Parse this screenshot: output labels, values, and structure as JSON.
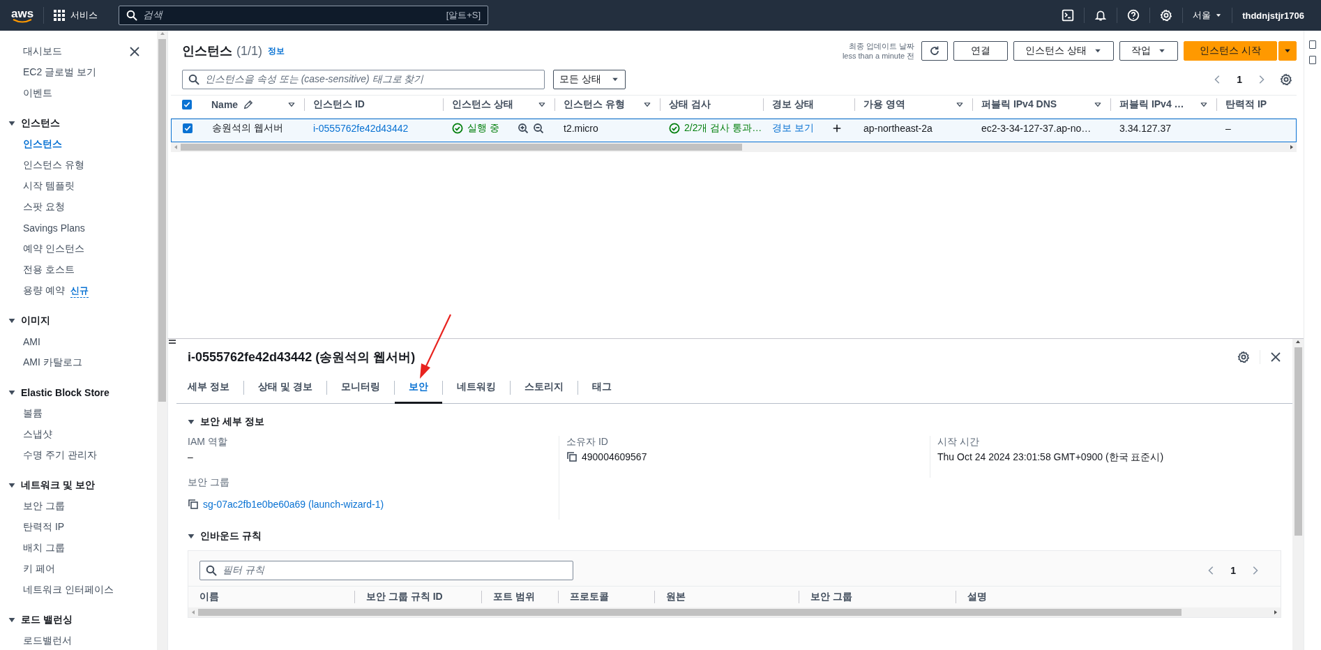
{
  "top_bar": {
    "logo": "aws",
    "services": "서비스",
    "search_placeholder": "검색",
    "search_shortcut": "[알트+S]",
    "region": "서울",
    "user": "thddnjstjr1706"
  },
  "sidebar": {
    "groups": [
      {
        "items": [
          {
            "label": "대시보드",
            "selected": false
          },
          {
            "label": "EC2 글로벌 보기",
            "selected": false
          },
          {
            "label": "이벤트",
            "selected": false
          }
        ]
      },
      {
        "title": "인스턴스",
        "expanded": true,
        "items": [
          {
            "label": "인스턴스",
            "selected": true
          },
          {
            "label": "인스턴스 유형",
            "selected": false
          },
          {
            "label": "시작 템플릿",
            "selected": false
          },
          {
            "label": "스팟 요청",
            "selected": false
          },
          {
            "label": "Savings Plans",
            "selected": false
          },
          {
            "label": "예약 인스턴스",
            "selected": false
          },
          {
            "label": "전용 호스트",
            "selected": false
          },
          {
            "label": "용량 예약",
            "selected": false,
            "badge": "신규"
          }
        ]
      },
      {
        "title": "이미지",
        "expanded": true,
        "items": [
          {
            "label": "AMI",
            "selected": false
          },
          {
            "label": "AMI 카탈로그",
            "selected": false
          }
        ]
      },
      {
        "title": "Elastic Block Store",
        "expanded": true,
        "items": [
          {
            "label": "볼륨",
            "selected": false
          },
          {
            "label": "스냅샷",
            "selected": false
          },
          {
            "label": "수명 주기 관리자",
            "selected": false
          }
        ]
      },
      {
        "title": "네트워크 및 보안",
        "expanded": true,
        "items": [
          {
            "label": "보안 그룹",
            "selected": false
          },
          {
            "label": "탄력적 IP",
            "selected": false
          },
          {
            "label": "배치 그룹",
            "selected": false
          },
          {
            "label": "키 페어",
            "selected": false
          },
          {
            "label": "네트워크 인터페이스",
            "selected": false
          }
        ]
      },
      {
        "title": "로드 밸런싱",
        "expanded": true,
        "items": [
          {
            "label": "로드밸런서",
            "selected": false
          }
        ]
      }
    ]
  },
  "instances": {
    "title": "인스턴스",
    "count": "(1/1)",
    "info": "정보",
    "last_updated_label": "최종 업데이트 날짜",
    "last_updated_value": "less than a minute 전",
    "actions": [
      {
        "kind": "refresh"
      },
      {
        "kind": "button",
        "label": "연결"
      },
      {
        "kind": "dropdown",
        "label": "인스턴스 상태"
      },
      {
        "kind": "dropdown",
        "label": "작업"
      },
      {
        "kind": "primary-split",
        "label": "인스턴스 시작"
      }
    ],
    "search_placeholder": "인스턴스을 속성 또는 (case-sensitive) 태그로 찾기",
    "state_filter": "모든 상태",
    "page": "1",
    "all_checked": true,
    "columns": [
      {
        "label": "Name",
        "sortable": true,
        "editable": true
      },
      {
        "label": "인스턴스 ID",
        "sortable": false,
        "editable": false
      },
      {
        "label": "인스턴스 상태",
        "sortable": true,
        "editable": false
      },
      {
        "label": "인스턴스 유형",
        "sortable": true,
        "editable": false
      },
      {
        "label": "상태 검사",
        "sortable": false,
        "editable": false
      },
      {
        "label": "경보 상태",
        "sortable": false,
        "editable": false
      },
      {
        "label": "가용 영역",
        "sortable": true,
        "editable": false
      },
      {
        "label": "퍼블릭 IPv4 DNS",
        "sortable": true,
        "editable": false
      },
      {
        "label": "퍼블릭 IPv4 …",
        "sortable": true,
        "editable": false
      },
      {
        "label": "탄력적 IP",
        "sortable": false,
        "editable": false
      }
    ],
    "rows": [
      {
        "checked": true,
        "name": "송원석의 웹서버",
        "id": "i-0555762fe42d43442",
        "state": "실행 중",
        "type": "t2.micro",
        "status_check": "2/2개 검사 통과…",
        "alarm": "경보 보기",
        "zone": "ap-northeast-2a",
        "dns": "ec2-3-34-127-37.ap-no…",
        "ipv4": "3.34.127.37",
        "elastic_ip": "–"
      }
    ]
  },
  "detail": {
    "title": "i-0555762fe42d43442 (송원석의 웹서버)",
    "tabs": [
      {
        "label": "세부 정보",
        "selected": false
      },
      {
        "label": "상태 및 경보",
        "selected": false
      },
      {
        "label": "모니터링",
        "selected": false
      },
      {
        "label": "보안",
        "selected": true
      },
      {
        "label": "네트워킹",
        "selected": false
      },
      {
        "label": "스토리지",
        "selected": false
      },
      {
        "label": "태그",
        "selected": false
      }
    ],
    "security_details": {
      "title": "보안 세부 정보",
      "expanded": true,
      "iam_label": "IAM 역할",
      "iam_value": "–",
      "sg_label": "보안 그룹",
      "sg_value": "sg-07ac2fb1e0be60a69 (launch-wizard-1)",
      "owner_label": "소유자 ID",
      "owner_value": "490004609567",
      "launch_label": "시작 시간",
      "launch_value": "Thu Oct 24 2024 23:01:58 GMT+0900 (한국 표준시)"
    },
    "inbound": {
      "title": "인바운드 규칙",
      "expanded": true,
      "filter_placeholder": "필터 규칙",
      "page": "1",
      "columns": [
        "이름",
        "보안 그룹 규칙 ID",
        "포트 범위",
        "프로토콜",
        "원본",
        "보안 그룹",
        "설명"
      ]
    }
  }
}
